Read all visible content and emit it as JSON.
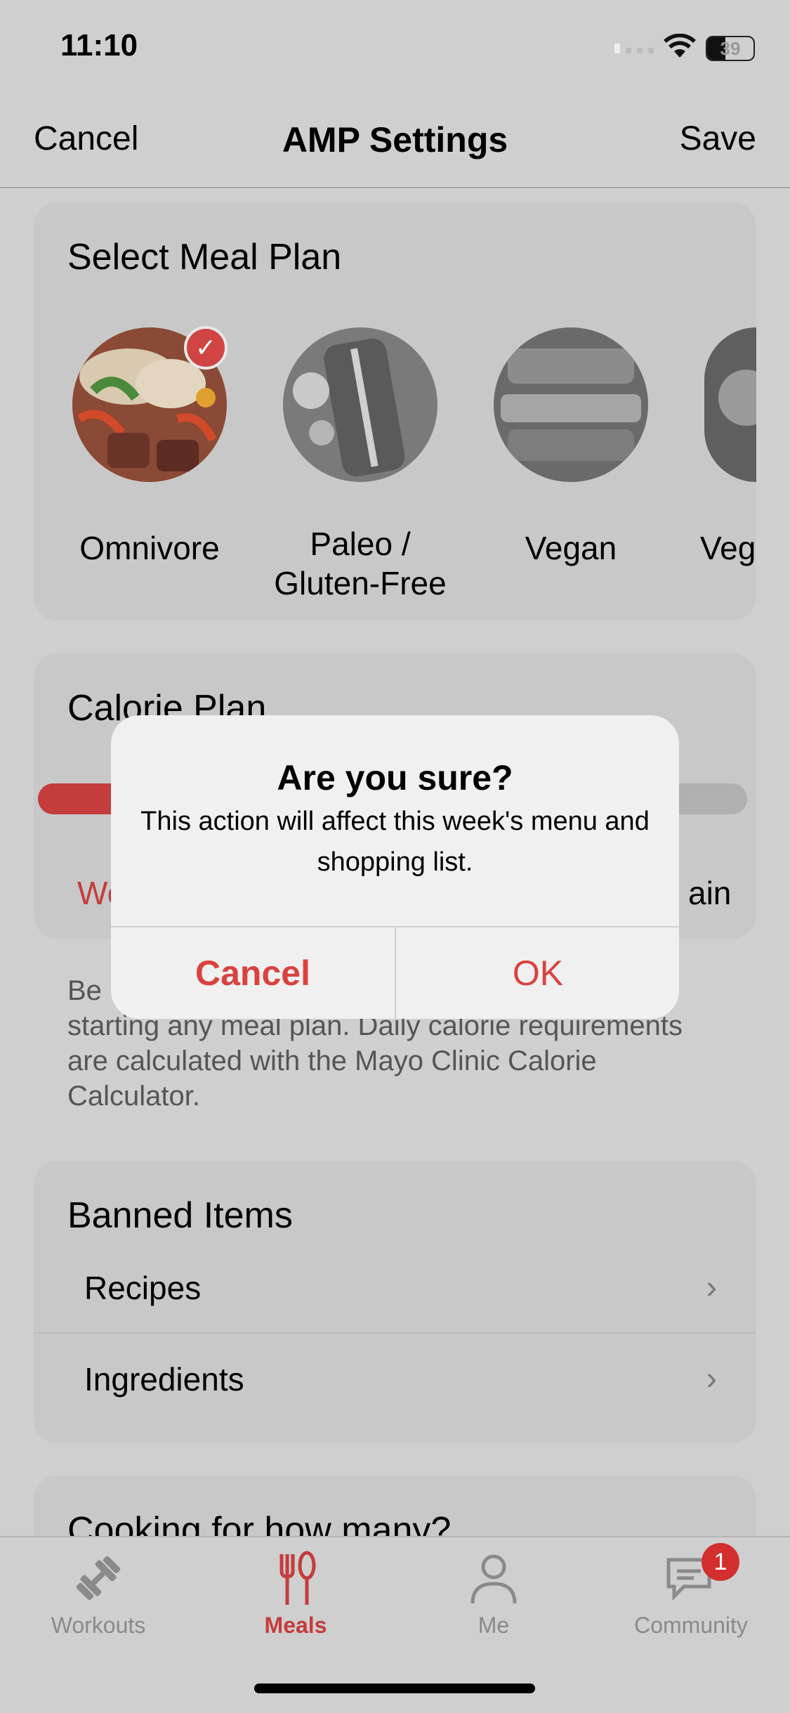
{
  "status_bar": {
    "time": "11:10",
    "battery": "39"
  },
  "nav": {
    "cancel": "Cancel",
    "title": "AMP Settings",
    "save": "Save"
  },
  "meal_plan": {
    "title": "Select Meal Plan",
    "options": [
      {
        "label": "Omnivore",
        "selected": true
      },
      {
        "label_line1": "Paleo /",
        "label_line2": "Gluten-Free"
      },
      {
        "label": "Vegan"
      },
      {
        "label": "Veg"
      }
    ]
  },
  "calorie_plan": {
    "title": "Calorie Plan",
    "left_label": "We",
    "right_label": "ain",
    "level_fraction": 0.42
  },
  "disclaimer": {
    "line1": "Be",
    "rest": "starting any meal plan. Daily calorie requirements are calculated with the Mayo Clinic Calorie Calculator."
  },
  "banned_items": {
    "title": "Banned Items",
    "rows": [
      {
        "label": "Recipes"
      },
      {
        "label": "Ingredients"
      }
    ]
  },
  "cooking": {
    "title": "Cooking for how many?"
  },
  "tabs": [
    {
      "label": "Workouts",
      "icon": "dumbbell-icon"
    },
    {
      "label": "Meals",
      "icon": "fork-spoon-icon",
      "active": true
    },
    {
      "label": "Me",
      "icon": "person-icon"
    },
    {
      "label": "Community",
      "icon": "chat-icon",
      "badge": "1"
    }
  ],
  "alert": {
    "title": "Are you sure?",
    "message": "This action will affect this week's menu and shopping list.",
    "cancel": "Cancel",
    "ok": "OK"
  },
  "colors": {
    "accent": "#d9423f",
    "overlay_background": "#cfcfcf"
  }
}
